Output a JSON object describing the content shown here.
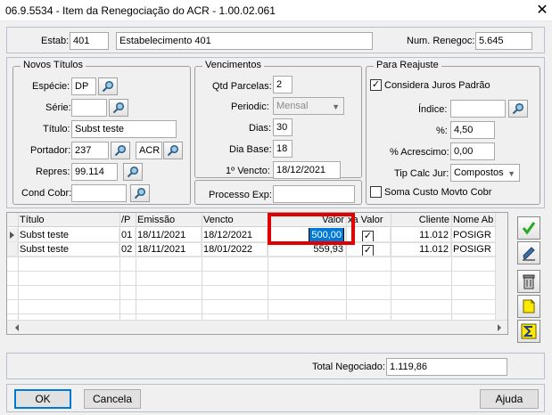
{
  "window": {
    "title": "06.9.5534 - Item da Renegociação do ACR - 1.00.02.061",
    "close_glyph": "✕"
  },
  "header": {
    "estab_label": "Estab:",
    "estab_code": "401",
    "estab_name": "Estabelecimento 401",
    "num_renegoc_label": "Num. Renegoc:",
    "num_renegoc_value": "5.645"
  },
  "novos_titulos": {
    "title": "Novos Títulos",
    "especie_label": "Espécie:",
    "especie_value": "DP",
    "serie_label": "Série:",
    "serie_value": "",
    "titulo_label": "Título:",
    "titulo_value": "Subst teste",
    "portador_label": "Portador:",
    "portador_value": "237",
    "carteira_value": "ACR",
    "repres_label": "Repres:",
    "repres_value": "99.114",
    "cond_cobr_label": "Cond Cobr:",
    "cond_cobr_value": ""
  },
  "vencimentos": {
    "title": "Vencimentos",
    "qtd_parcelas_label": "Qtd Parcelas:",
    "qtd_parcelas_value": "2",
    "periodic_label": "Periodic:",
    "periodic_value": "Mensal",
    "dias_label": "Dias:",
    "dias_value": "30",
    "dia_base_label": "Dia Base:",
    "dia_base_value": "18",
    "primeiro_vencto_label": "1º Vencto:",
    "primeiro_vencto_value": "18/12/2021",
    "processo_exp_label": "Processo Exp:",
    "processo_exp_value": ""
  },
  "para_reajuste": {
    "title": "Para Reajuste",
    "considera_juros_label": "Considera Juros Padrão",
    "considera_juros_checked": true,
    "indice_label": "Índice:",
    "indice_value": "",
    "pct_label": "%:",
    "pct_value": "4,50",
    "pct_acrescimo_label": "% Acrescimo:",
    "pct_acrescimo_value": "0,00",
    "tip_calc_jur_label": "Tip Calc Jur:",
    "tip_calc_jur_value": "Compostos",
    "soma_custo_label": "Soma Custo Movto Cobr",
    "soma_custo_checked": false
  },
  "grid": {
    "columns": [
      "Título",
      "/P",
      "Emissão",
      "Vencto",
      "Valor",
      "xa Valor",
      "Cliente",
      "Nome Ab"
    ],
    "rows": [
      {
        "titulo": "Subst teste",
        "parcela": "01",
        "emissao": "18/11/2021",
        "vencto": "18/12/2021",
        "valor": "500,00",
        "baixa_valor": true,
        "cliente": "11.012",
        "nome_ab": "POSIGR"
      },
      {
        "titulo": "Subst teste",
        "parcela": "02",
        "emissao": "18/11/2021",
        "vencto": "18/01/2022",
        "valor": "559,93",
        "baixa_valor": true,
        "cliente": "11.012",
        "nome_ab": "POSIGR"
      }
    ],
    "highlight_color": "#e00000",
    "selection_color": "#0078d7"
  },
  "footer": {
    "total_label": "Total Negociado:",
    "total_value": "1.119,86",
    "ok_label": "OK",
    "cancel_label": "Cancela",
    "help_label": "Ajuda"
  },
  "toolbar_icons": [
    "checkmark-icon",
    "edit-pen-icon",
    "trash-icon",
    "note-icon",
    "sigma-icon"
  ]
}
